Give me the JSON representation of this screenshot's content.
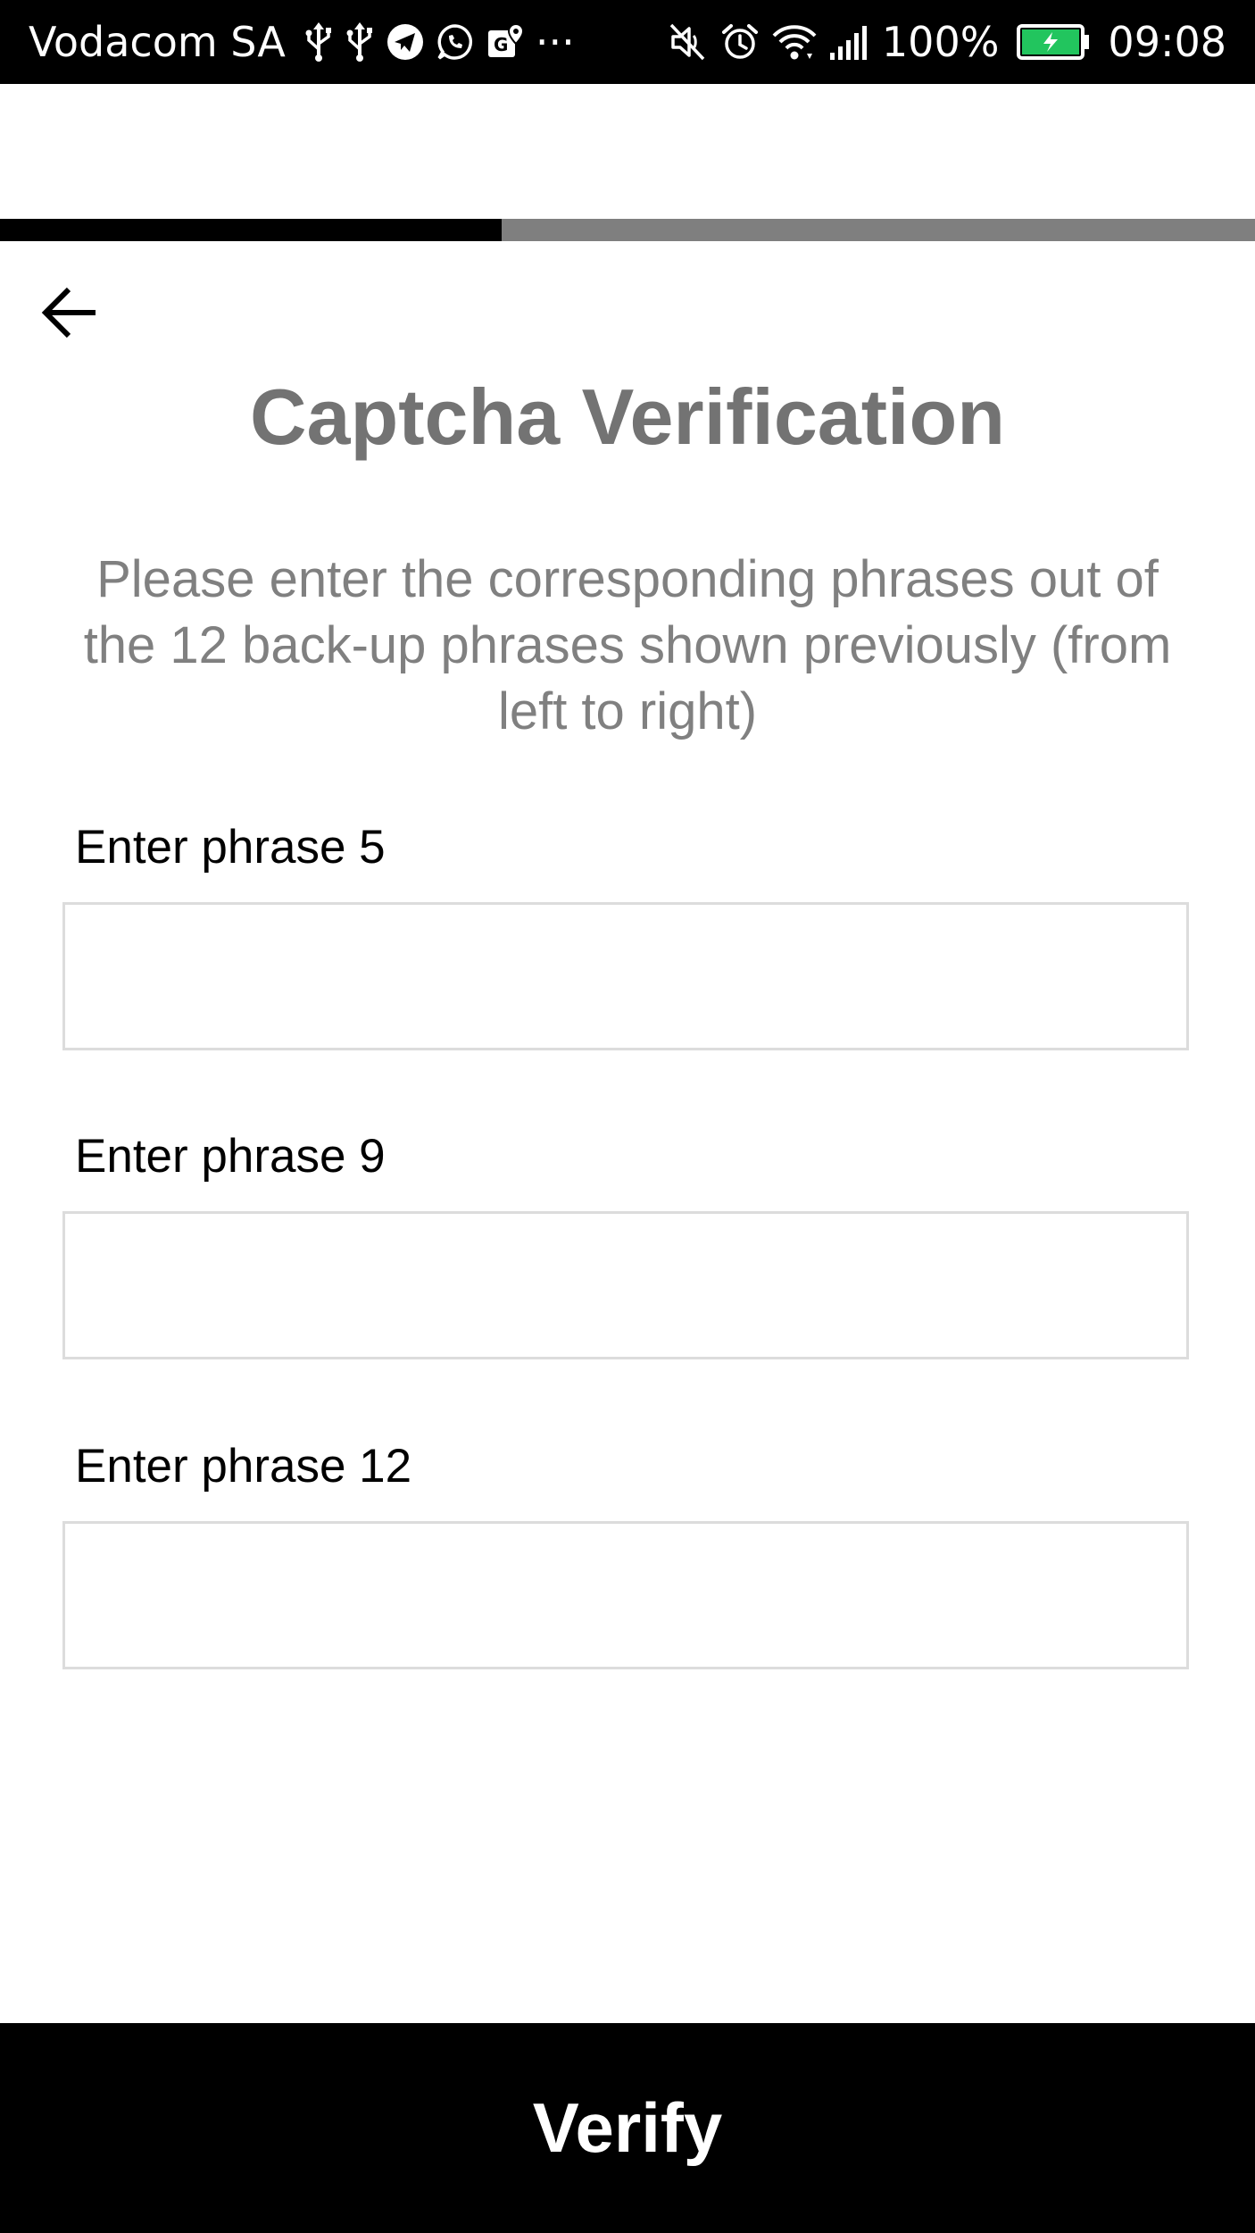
{
  "status_bar": {
    "carrier": "Vodacom SA",
    "overflow": "···",
    "battery_percent": "100%",
    "time": "09:08",
    "left_icons": [
      "usb-icon",
      "usb-icon",
      "telegram-icon",
      "whatsapp-icon",
      "maps-icon"
    ],
    "right_icons": [
      "mute-icon",
      "alarm-icon",
      "wifi-icon",
      "signal-icon",
      "battery-icon"
    ],
    "battery_color": "#22c55e"
  },
  "progress": {
    "value": 0.4,
    "fill_color": "#000000",
    "track_color": "#7f7f7f"
  },
  "header": {
    "back_icon": "arrow-left-icon",
    "title": "Captcha Verification"
  },
  "instructions": "Please enter the corresponding phrases out of the 12 back-up phrases shown previously (from left to right)",
  "fields": [
    {
      "label": "Enter phrase 5",
      "value": "",
      "placeholder": ""
    },
    {
      "label": "Enter phrase 9",
      "value": "",
      "placeholder": ""
    },
    {
      "label": "Enter phrase 12",
      "value": "",
      "placeholder": ""
    }
  ],
  "verify_button": {
    "label": "Verify"
  },
  "colors": {
    "title": "#737373",
    "instructions": "#808080",
    "input_border": "#dcdcdc"
  }
}
